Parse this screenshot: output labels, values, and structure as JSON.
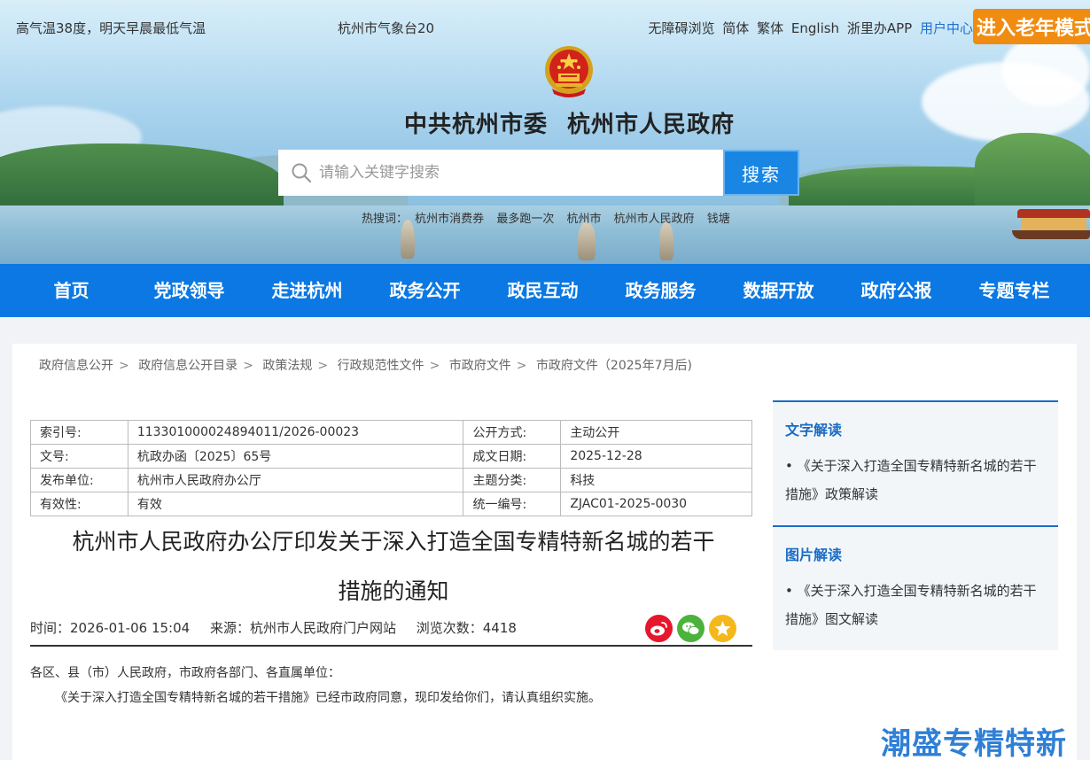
{
  "topbar": {
    "weather_left": "高气温38度，明天早晨最低气温",
    "weather_right": "杭州市气象台20",
    "links": [
      "无障碍浏览",
      "简体",
      "繁体",
      "English",
      "浙里办APP"
    ],
    "user_center": "用户中心",
    "elder_mode": "进入老年模式"
  },
  "header": {
    "title": "中共杭州市委 杭州市人民政府",
    "search_placeholder": "请输入关键字搜索",
    "search_button": "搜索",
    "hot_label": "热搜词：",
    "hot_words": [
      "杭州市消费券",
      "最多跑一次",
      "杭州市",
      "杭州市人民政府",
      "钱塘"
    ]
  },
  "nav": [
    "首页",
    "党政领导",
    "走进杭州",
    "政务公开",
    "政民互动",
    "政务服务",
    "数据开放",
    "政府公报",
    "专题专栏"
  ],
  "breadcrumb": [
    "政府信息公开",
    "政府信息公开目录",
    "政策法规",
    "行政规范性文件",
    "市政府文件",
    "市政府文件（2025年7月后)"
  ],
  "meta": [
    {
      "k1": "索引号:",
      "v1": "113301000024894011/2026-00023",
      "k2": "公开方式:",
      "v2": "主动公开"
    },
    {
      "k1": "文号:",
      "v1": "杭政办函〔2025〕65号",
      "k2": "成文日期:",
      "v2": "2025-12-28"
    },
    {
      "k1": "发布单位:",
      "v1": "杭州市人民政府办公厅",
      "k2": "主题分类:",
      "v2": "科技"
    },
    {
      "k1": "有效性:",
      "v1": "有效",
      "k2": "统一编号:",
      "v2": "ZJAC01-2025-0030"
    }
  ],
  "article": {
    "title_line1": "杭州市人民政府办公厅印发关于深入打造全国专精特新名城的若干",
    "title_line2": "措施的通知",
    "time": "时间：2026-01-06 15:04",
    "source": "来源：杭州市人民政府门户网站",
    "views": "浏览次数：4418",
    "salutation": "各区、县（市）人民政府，市政府各部门、各直属单位：",
    "paragraph1": "《关于深入打造全国专精特新名城的若干措施》已经市政府同意，现印发给你们，请认真组织实施。"
  },
  "sidebar": {
    "text_reading_title": "文字解读",
    "text_reading_item": "•  《关于深入打造全国专精特新名城的若干措施》政策解读",
    "image_reading_title": "图片解读",
    "image_reading_item": "•  《关于深入打造全国专精特新名城的若干措施》图文解读"
  },
  "float_banner": "潮盛专精特新",
  "colors": {
    "nav_blue": "#0b78e3",
    "elder_orange": "#f08c12",
    "accent_blue": "#1a6cc6"
  }
}
